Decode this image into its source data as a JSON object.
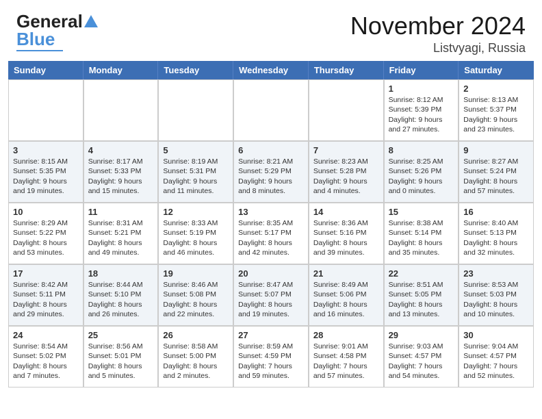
{
  "header": {
    "logo_line1": "General",
    "logo_line2": "Blue",
    "month": "November 2024",
    "location": "Listvyagi, Russia"
  },
  "weekdays": [
    "Sunday",
    "Monday",
    "Tuesday",
    "Wednesday",
    "Thursday",
    "Friday",
    "Saturday"
  ],
  "weeks": [
    [
      {
        "day": "",
        "info": ""
      },
      {
        "day": "",
        "info": ""
      },
      {
        "day": "",
        "info": ""
      },
      {
        "day": "",
        "info": ""
      },
      {
        "day": "",
        "info": ""
      },
      {
        "day": "1",
        "info": "Sunrise: 8:12 AM\nSunset: 5:39 PM\nDaylight: 9 hours\nand 27 minutes."
      },
      {
        "day": "2",
        "info": "Sunrise: 8:13 AM\nSunset: 5:37 PM\nDaylight: 9 hours\nand 23 minutes."
      }
    ],
    [
      {
        "day": "3",
        "info": "Sunrise: 8:15 AM\nSunset: 5:35 PM\nDaylight: 9 hours\nand 19 minutes."
      },
      {
        "day": "4",
        "info": "Sunrise: 8:17 AM\nSunset: 5:33 PM\nDaylight: 9 hours\nand 15 minutes."
      },
      {
        "day": "5",
        "info": "Sunrise: 8:19 AM\nSunset: 5:31 PM\nDaylight: 9 hours\nand 11 minutes."
      },
      {
        "day": "6",
        "info": "Sunrise: 8:21 AM\nSunset: 5:29 PM\nDaylight: 9 hours\nand 8 minutes."
      },
      {
        "day": "7",
        "info": "Sunrise: 8:23 AM\nSunset: 5:28 PM\nDaylight: 9 hours\nand 4 minutes."
      },
      {
        "day": "8",
        "info": "Sunrise: 8:25 AM\nSunset: 5:26 PM\nDaylight: 9 hours\nand 0 minutes."
      },
      {
        "day": "9",
        "info": "Sunrise: 8:27 AM\nSunset: 5:24 PM\nDaylight: 8 hours\nand 57 minutes."
      }
    ],
    [
      {
        "day": "10",
        "info": "Sunrise: 8:29 AM\nSunset: 5:22 PM\nDaylight: 8 hours\nand 53 minutes."
      },
      {
        "day": "11",
        "info": "Sunrise: 8:31 AM\nSunset: 5:21 PM\nDaylight: 8 hours\nand 49 minutes."
      },
      {
        "day": "12",
        "info": "Sunrise: 8:33 AM\nSunset: 5:19 PM\nDaylight: 8 hours\nand 46 minutes."
      },
      {
        "day": "13",
        "info": "Sunrise: 8:35 AM\nSunset: 5:17 PM\nDaylight: 8 hours\nand 42 minutes."
      },
      {
        "day": "14",
        "info": "Sunrise: 8:36 AM\nSunset: 5:16 PM\nDaylight: 8 hours\nand 39 minutes."
      },
      {
        "day": "15",
        "info": "Sunrise: 8:38 AM\nSunset: 5:14 PM\nDaylight: 8 hours\nand 35 minutes."
      },
      {
        "day": "16",
        "info": "Sunrise: 8:40 AM\nSunset: 5:13 PM\nDaylight: 8 hours\nand 32 minutes."
      }
    ],
    [
      {
        "day": "17",
        "info": "Sunrise: 8:42 AM\nSunset: 5:11 PM\nDaylight: 8 hours\nand 29 minutes."
      },
      {
        "day": "18",
        "info": "Sunrise: 8:44 AM\nSunset: 5:10 PM\nDaylight: 8 hours\nand 26 minutes."
      },
      {
        "day": "19",
        "info": "Sunrise: 8:46 AM\nSunset: 5:08 PM\nDaylight: 8 hours\nand 22 minutes."
      },
      {
        "day": "20",
        "info": "Sunrise: 8:47 AM\nSunset: 5:07 PM\nDaylight: 8 hours\nand 19 minutes."
      },
      {
        "day": "21",
        "info": "Sunrise: 8:49 AM\nSunset: 5:06 PM\nDaylight: 8 hours\nand 16 minutes."
      },
      {
        "day": "22",
        "info": "Sunrise: 8:51 AM\nSunset: 5:05 PM\nDaylight: 8 hours\nand 13 minutes."
      },
      {
        "day": "23",
        "info": "Sunrise: 8:53 AM\nSunset: 5:03 PM\nDaylight: 8 hours\nand 10 minutes."
      }
    ],
    [
      {
        "day": "24",
        "info": "Sunrise: 8:54 AM\nSunset: 5:02 PM\nDaylight: 8 hours\nand 7 minutes."
      },
      {
        "day": "25",
        "info": "Sunrise: 8:56 AM\nSunset: 5:01 PM\nDaylight: 8 hours\nand 5 minutes."
      },
      {
        "day": "26",
        "info": "Sunrise: 8:58 AM\nSunset: 5:00 PM\nDaylight: 8 hours\nand 2 minutes."
      },
      {
        "day": "27",
        "info": "Sunrise: 8:59 AM\nSunset: 4:59 PM\nDaylight: 7 hours\nand 59 minutes."
      },
      {
        "day": "28",
        "info": "Sunrise: 9:01 AM\nSunset: 4:58 PM\nDaylight: 7 hours\nand 57 minutes."
      },
      {
        "day": "29",
        "info": "Sunrise: 9:03 AM\nSunset: 4:57 PM\nDaylight: 7 hours\nand 54 minutes."
      },
      {
        "day": "30",
        "info": "Sunrise: 9:04 AM\nSunset: 4:57 PM\nDaylight: 7 hours\nand 52 minutes."
      }
    ]
  ]
}
